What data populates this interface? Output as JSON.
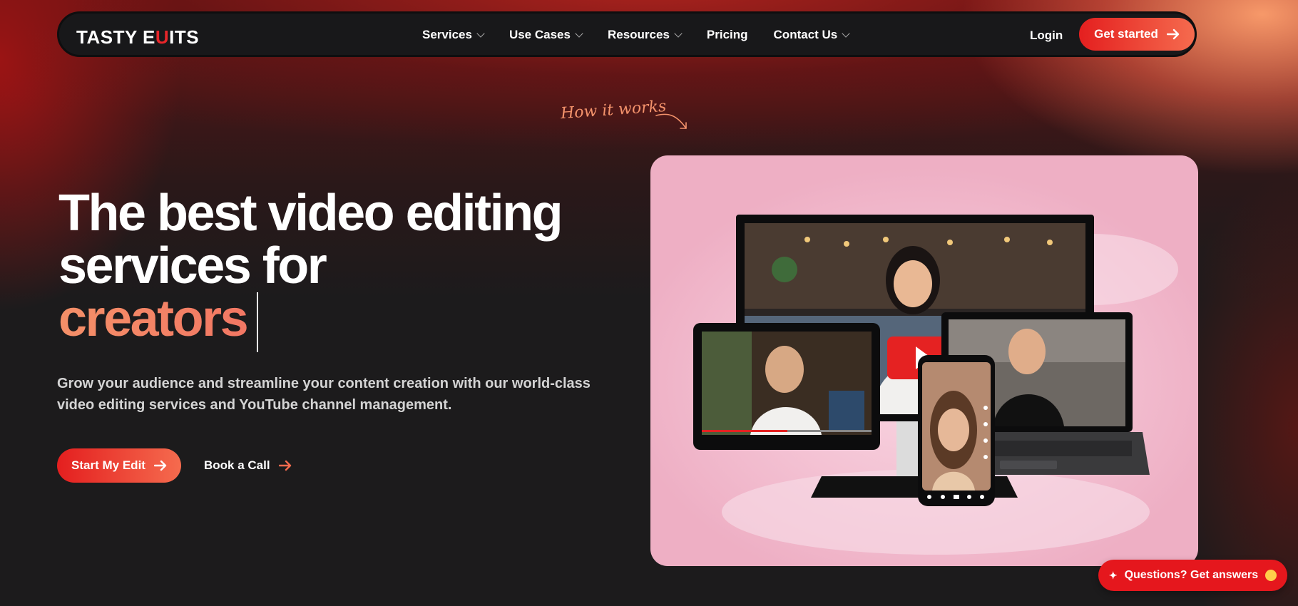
{
  "brand": {
    "name_part1": "TASTY E",
    "name_mark": "U",
    "name_part2": "ITS"
  },
  "nav": {
    "items": [
      {
        "label": "Services",
        "has_dropdown": true
      },
      {
        "label": "Use Cases",
        "has_dropdown": true
      },
      {
        "label": "Resources",
        "has_dropdown": true
      },
      {
        "label": "Pricing",
        "has_dropdown": false
      },
      {
        "label": "Contact Us",
        "has_dropdown": true
      }
    ],
    "login_label": "Login",
    "cta_label": "Get started"
  },
  "how_it_works": "How it works",
  "hero": {
    "title_line1": "The best video editing",
    "title_line2": "services for",
    "title_accent": "creators",
    "subtitle": "Grow your audience and streamline your content creation with our world-class video editing services and YouTube channel management.",
    "primary_cta": "Start My Edit",
    "secondary_cta": "Book a Call"
  },
  "chat_widget": {
    "label": "Questions? Get answers"
  },
  "colors": {
    "accent_red": "#e41f1f",
    "accent_orange": "#f56b4e",
    "card_pink": "#f3bfd1",
    "page_bg": "#1c1b1c"
  }
}
